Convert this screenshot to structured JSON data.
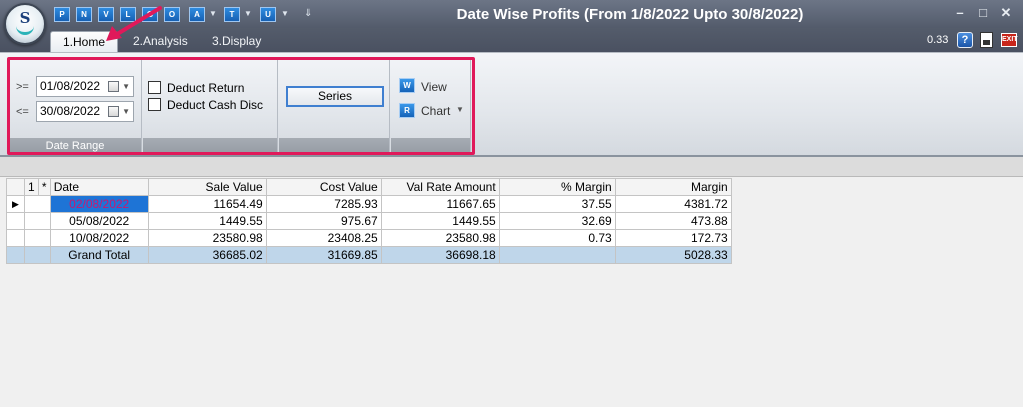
{
  "window": {
    "title": "Date Wise Profits (From 1/8/2022 Upto 30/8/2022)",
    "minimize": "–",
    "maximize": "□",
    "close": "✕"
  },
  "app": {
    "logo_text": "S"
  },
  "quick_access": [
    {
      "icon_text": "P"
    },
    {
      "icon_text": "N"
    },
    {
      "icon_text": "V"
    },
    {
      "icon_text": "L"
    },
    {
      "icon_text": "G"
    },
    {
      "icon_text": "O"
    },
    {
      "icon_text": "A"
    },
    {
      "icon_text": "T"
    },
    {
      "icon_text": "U"
    }
  ],
  "tabs": [
    {
      "label": "1.Home",
      "active": true
    },
    {
      "label": "2.Analysis"
    },
    {
      "label": "3.Display"
    }
  ],
  "toolbar_right": {
    "zoom": "0.33",
    "help_icon": "?",
    "exit_icon": "EXIT"
  },
  "ribbon": {
    "date_range": {
      "caption": "Date Range",
      "from_operator": ">=",
      "from_value": "01/08/2022",
      "to_operator": "<=",
      "to_value": "30/08/2022"
    },
    "options": {
      "deduct_return_label": "Deduct Return",
      "deduct_cash_disc_label": "Deduct Cash Disc"
    },
    "series_button": "Series",
    "view_label": "View",
    "chart_label": "Chart",
    "view_icon_text": "W",
    "chart_icon_text": "R"
  },
  "grid": {
    "headers": {
      "num": "1",
      "star": "*",
      "date": "Date",
      "sale": "Sale Value",
      "cost": "Cost Value",
      "val_rate": "Val Rate Amount",
      "pct_margin": "% Margin",
      "margin": "Margin"
    },
    "rows": [
      {
        "date": "02/08/2022",
        "sale": "11654.49",
        "cost": "7285.93",
        "val_rate": "11667.65",
        "pct_margin": "37.55",
        "margin": "4381.72"
      },
      {
        "date": "05/08/2022",
        "sale": "1449.55",
        "cost": "975.67",
        "val_rate": "1449.55",
        "pct_margin": "32.69",
        "margin": "473.88"
      },
      {
        "date": "10/08/2022",
        "sale": "23580.98",
        "cost": "23408.25",
        "val_rate": "23580.98",
        "pct_margin": "0.73",
        "margin": "172.73"
      }
    ],
    "total": {
      "label": "Grand Total",
      "sale": "36685.02",
      "cost": "31669.85",
      "val_rate": "36698.18",
      "pct_margin": "",
      "margin": "5028.33"
    }
  },
  "colors": {
    "title_bar": "#5f6878",
    "highlight": "#e0195a",
    "selected_cell": "#1e74d6",
    "total_row": "#bfd6ea"
  }
}
